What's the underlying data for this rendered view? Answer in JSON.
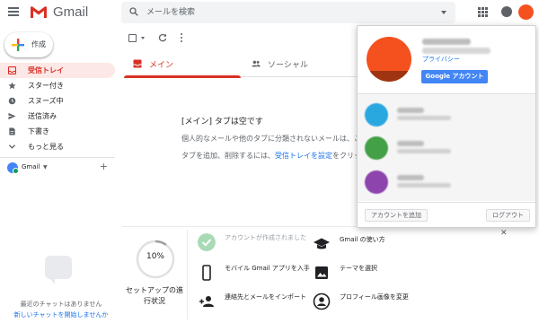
{
  "app": {
    "name": "Gmail",
    "brand_color": "#d93025"
  },
  "search": {
    "placeholder": "メールを検索"
  },
  "sidebar": {
    "compose_label": "作成",
    "items": [
      {
        "label": "受信トレイ",
        "icon": "inbox-icon",
        "active": true
      },
      {
        "label": "スター付き",
        "icon": "star-icon",
        "active": false
      },
      {
        "label": "スヌーズ中",
        "icon": "clock-icon",
        "active": false
      },
      {
        "label": "送信済み",
        "icon": "send-icon",
        "active": false
      },
      {
        "label": "下書き",
        "icon": "draft-icon",
        "active": false
      },
      {
        "label": "もっと見る",
        "icon": "chevron-down-icon",
        "active": false
      }
    ],
    "account_label": "Gmail",
    "chat_empty": "最近のチャットはありません",
    "chat_start": "新しいチャットを開始しませんか"
  },
  "tabs": [
    {
      "label": "メイン",
      "icon": "inbox-icon",
      "active": true
    },
    {
      "label": "ソーシャル",
      "icon": "people-icon",
      "active": false
    }
  ],
  "empty_state": {
    "title": "[メイン] タブは空です",
    "line1": "個人的なメールや他のタブに分類されないメールは、こ",
    "line2_prefix": "タブを追加、削除するには、",
    "line2_link": "受信トレイを設定",
    "line2_suffix": "をクリック"
  },
  "setup": {
    "progress": "10%",
    "progress_fraction": 0.1,
    "status": "セットアップの進行状況",
    "tasks": [
      {
        "text": "アカウントが作成されました",
        "icon": "check-icon",
        "done": true
      },
      {
        "text": "モバイル Gmail アプリを入手",
        "icon": "phone-icon",
        "done": false
      },
      {
        "text": "連絡先とメールをインポート",
        "icon": "person-add-icon",
        "done": false
      },
      {
        "text": "Gmail の使い方",
        "icon": "school-icon",
        "done": false
      },
      {
        "text": "テーマを選択",
        "icon": "image-icon",
        "done": false
      },
      {
        "text": "プロフィール画像を変更",
        "icon": "account-icon",
        "done": false
      }
    ]
  },
  "popup": {
    "privacy": "プライバシー",
    "google_account_btn": "Google アカウント",
    "add_account": "アカウントを追加",
    "logout": "ログアウト",
    "accounts": [
      {
        "avatar_color": "#29a8e0"
      },
      {
        "avatar_color": "#43a047"
      },
      {
        "avatar_color": "#8e44ad"
      }
    ]
  }
}
